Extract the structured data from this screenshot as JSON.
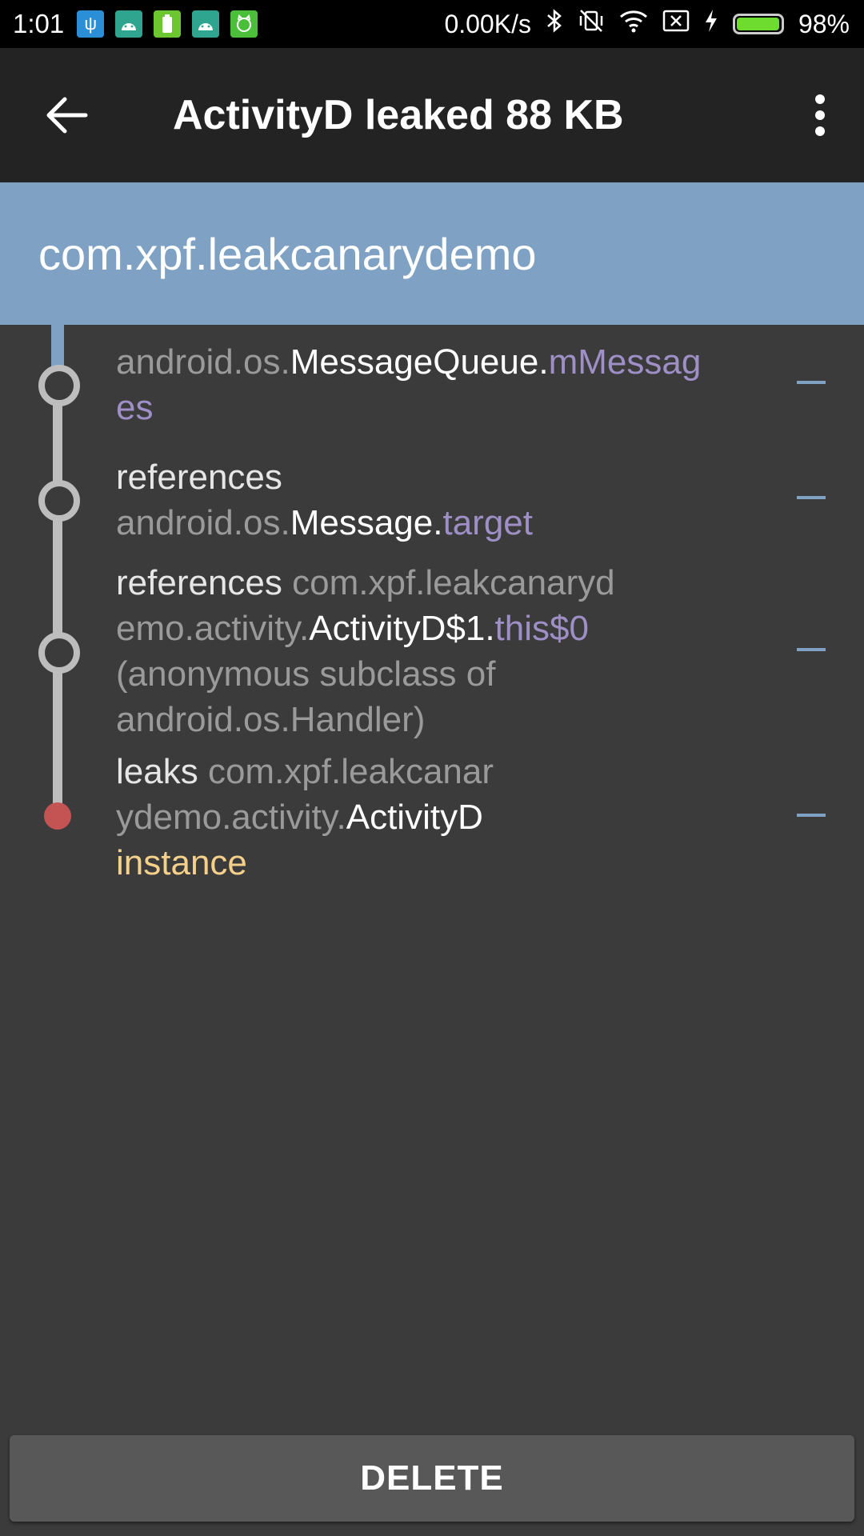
{
  "status_bar": {
    "time": "1:01",
    "network_speed": "0.00K/s",
    "battery_percent": "98%",
    "battery_level": 0.98,
    "notification_icons": [
      "usb-icon",
      "android-icon",
      "battery-saver-icon",
      "android-icon",
      "cat-app-icon"
    ],
    "status_icons": [
      "bluetooth-icon",
      "vibrate-off-icon",
      "wifi-icon",
      "sim-x-icon",
      "charging-icon"
    ]
  },
  "app_bar": {
    "title": "ActivityD leaked 88 KB"
  },
  "package_header": {
    "name": "com.xpf.leakcanarydemo"
  },
  "trace": [
    {
      "l1_pkg": "android.os.",
      "l1_class": "MessageQueue.",
      "l1_field": "mMessag",
      "l2_field": "es"
    },
    {
      "ref": "references",
      "pkg": "android.os.",
      "class": "Message.",
      "field": "target"
    },
    {
      "ref": "references",
      "l1_pkg": "com.xpf.leakcanaryd",
      "l2_pkg": "emo.activity.",
      "class": "ActivityD$1.",
      "field": "this$0",
      "l3": "(anonymous subclass of",
      "l4": "android.os.Handler)"
    },
    {
      "ref": "leaks",
      "l1_pkg": "com.xpf.leakcanar",
      "l2_pkg": "ydemo.activity.",
      "class": "ActivityD",
      "instance": "instance"
    }
  ],
  "delete_button": {
    "label": "DELETE"
  },
  "colors": {
    "accent": "#7fa2c4",
    "background": "#3b3b3b",
    "field": "#9e8fc6",
    "instance": "#f5d08a",
    "leak_dot": "#c45454"
  }
}
